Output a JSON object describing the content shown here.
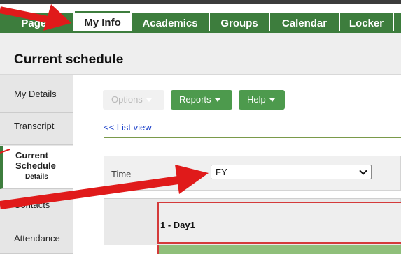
{
  "tabs": [
    {
      "label": "Pages"
    },
    {
      "label": "My Info"
    },
    {
      "label": "Academics"
    },
    {
      "label": "Groups"
    },
    {
      "label": "Calendar"
    },
    {
      "label": "Locker"
    }
  ],
  "page": {
    "title": "Current schedule"
  },
  "sidebar": {
    "items": [
      {
        "label": "My Details"
      },
      {
        "label": "Transcript"
      },
      {
        "label": "Current Schedule",
        "sub": "Details"
      },
      {
        "label": "Contacts"
      },
      {
        "label": "Attendance"
      }
    ]
  },
  "toolbar": {
    "options_label": "Options",
    "reports_label": "Reports",
    "help_label": "Help"
  },
  "links": {
    "list_view": "<< List view"
  },
  "filter": {
    "label": "Time",
    "selected": "FY"
  },
  "grid": {
    "day_label": "1 - Day1"
  },
  "colors": {
    "tab_green": "#3d7d3d",
    "button_green": "#4d9a4d",
    "annotation_red": "#e01a1a",
    "link_blue": "#1a3fc9"
  }
}
